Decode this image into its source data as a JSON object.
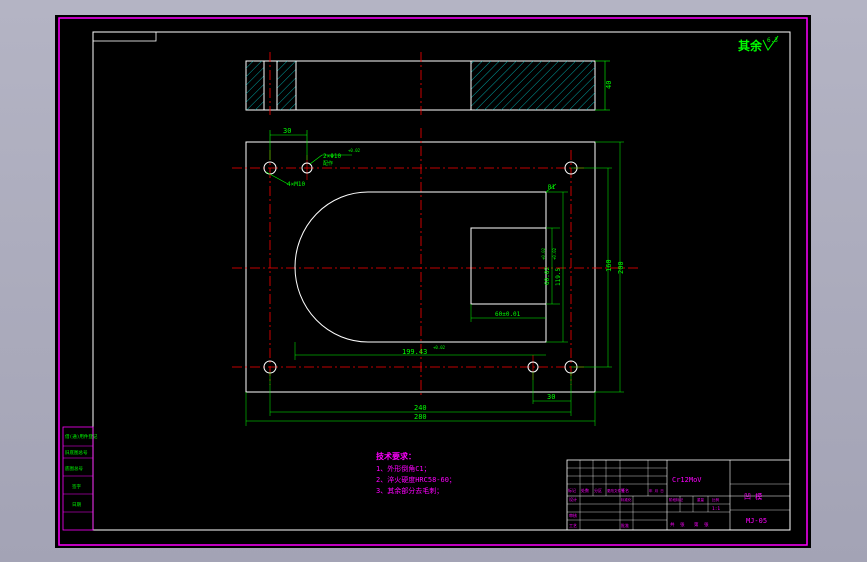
{
  "drawing": {
    "roughness_note": "其余",
    "roughness_symbol": "6.3",
    "section": {
      "height_dim": "40"
    },
    "plan": {
      "dim_hole_offset": "30",
      "dim_hole_fit": "2×Φ10",
      "dim_hole_fit_tol": "+0.02",
      "dim_hole_note": "配作",
      "dim_thread": "4×M10",
      "dim_radius": "R1",
      "dim_slot_inner": "60.02",
      "dim_slot_inner_tol": "+0.02",
      "dim_slot_outer": "119.5",
      "dim_slot_outer_tol": "+0.02",
      "dim_height_inner": "160",
      "dim_height_outer": "200",
      "dim_slot_width": "60±0.01",
      "dim_opening": "199.43",
      "dim_opening_tol": "+0.02",
      "dim_bottom_offset": "30",
      "dim_width_inner": "240",
      "dim_width_outer": "280"
    },
    "tech_req": {
      "title": "技术要求：",
      "items": [
        "1、外形倒角C1；",
        "2、淬火硬度HRC58-60；",
        "3、其余部分去毛刺；"
      ]
    },
    "title_block": {
      "material": "Cr12MoV",
      "part_name": "凹  模",
      "drawing_no": "MJ-05",
      "scale": "1:1",
      "header_cells": [
        "标记",
        "处数",
        "分区",
        "更改文件号",
        "签名",
        "年 月 日"
      ],
      "role_cells": [
        "设计",
        "标准化",
        "阶段标记",
        "重量",
        "比例"
      ],
      "lower_cells": [
        "审核",
        "工艺",
        "批准"
      ],
      "sheet_cells": [
        "共",
        "张",
        "第",
        "张"
      ]
    },
    "side_table": {
      "rows": [
        "借(通)用件登记",
        "旧底图总号",
        "底图总号",
        "签字",
        "日期"
      ]
    }
  }
}
